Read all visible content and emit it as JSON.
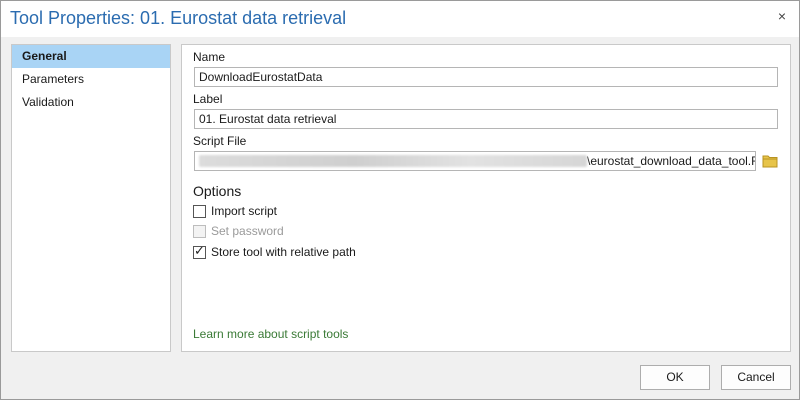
{
  "window": {
    "title": "Tool Properties: 01. Eurostat data retrieval",
    "close_icon": "×"
  },
  "sidebar": {
    "items": [
      {
        "label": "General",
        "active": true
      },
      {
        "label": "Parameters",
        "active": false
      },
      {
        "label": "Validation",
        "active": false
      }
    ]
  },
  "general": {
    "name_label": "Name",
    "name_value": "DownloadEurostatData",
    "label_label": "Label",
    "label_value": "01. Eurostat data retrieval",
    "script_label": "Script File",
    "script_value_visible": "\\eurostat_download_data_tool.R",
    "folder_icon": "folder-icon",
    "options_title": "Options",
    "options": [
      {
        "label": "Import script",
        "checked": false,
        "disabled": false
      },
      {
        "label": "Set password",
        "checked": false,
        "disabled": true
      },
      {
        "label": "Store tool with relative path",
        "checked": true,
        "disabled": false
      }
    ],
    "learn_more": "Learn more about script tools"
  },
  "footer": {
    "ok": "OK",
    "cancel": "Cancel"
  },
  "colors": {
    "accent": "#2b6cb0",
    "sidebar_active": "#a9d4f5",
    "link": "#3a7a36"
  }
}
